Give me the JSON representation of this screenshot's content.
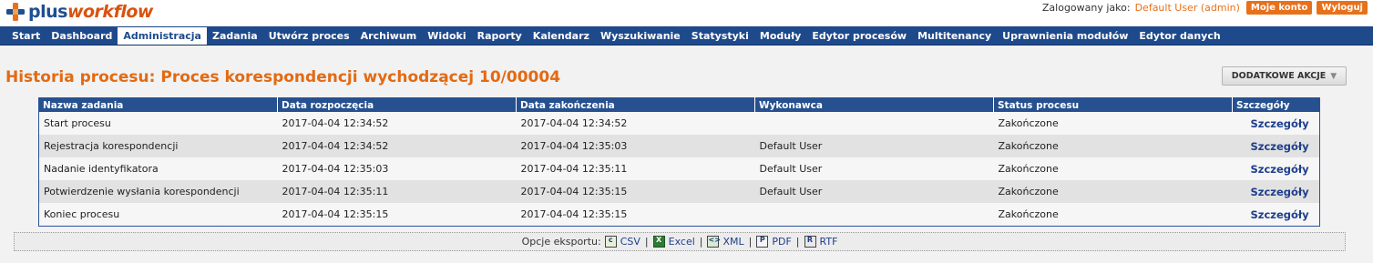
{
  "app": {
    "logo_plus": "plus",
    "logo_workflow": "workflow"
  },
  "user": {
    "logged_in_label": "Zalogowany jako:",
    "name": "Default User (admin)",
    "my_account": "Moje konto",
    "logout": "Wyloguj"
  },
  "nav": {
    "items": [
      {
        "label": "Start"
      },
      {
        "label": "Dashboard"
      },
      {
        "label": "Administracja",
        "active": true
      },
      {
        "label": "Zadania"
      },
      {
        "label": "Utwórz proces"
      },
      {
        "label": "Archiwum"
      },
      {
        "label": "Widoki"
      },
      {
        "label": "Raporty"
      },
      {
        "label": "Kalendarz"
      },
      {
        "label": "Wyszukiwanie"
      },
      {
        "label": "Statystyki"
      },
      {
        "label": "Moduły"
      },
      {
        "label": "Edytor procesów"
      },
      {
        "label": "Multitenancy"
      },
      {
        "label": "Uprawnienia modułów"
      },
      {
        "label": "Edytor danych"
      }
    ]
  },
  "page": {
    "title": "Historia procesu: Proces korespondencji wychodzącej 10/00004",
    "actions_button": "DODATKOWE AKCJE",
    "actions_caret_icon": "caret-down-icon"
  },
  "table": {
    "columns": [
      "Nazwa zadania",
      "Data rozpoczęcia",
      "Data zakończenia",
      "Wykonawca",
      "Status procesu",
      "Szczegóły"
    ],
    "rows": [
      {
        "task": "Start procesu",
        "start": "2017-04-04 12:34:52",
        "end": "2017-04-04 12:34:52",
        "assignee": "",
        "status": "Zakończone",
        "details": "Szczegóły"
      },
      {
        "task": "Rejestracja korespondencji",
        "start": "2017-04-04 12:34:52",
        "end": "2017-04-04 12:35:03",
        "assignee": "Default User",
        "status": "Zakończone",
        "details": "Szczegóły"
      },
      {
        "task": "Nadanie identyfikatora",
        "start": "2017-04-04 12:35:03",
        "end": "2017-04-04 12:35:11",
        "assignee": "Default User",
        "status": "Zakończone",
        "details": "Szczegóły"
      },
      {
        "task": "Potwierdzenie wysłania korespondencji",
        "start": "2017-04-04 12:35:11",
        "end": "2017-04-04 12:35:15",
        "assignee": "Default User",
        "status": "Zakończone",
        "details": "Szczegóły"
      },
      {
        "task": "Koniec procesu",
        "start": "2017-04-04 12:35:15",
        "end": "2017-04-04 12:35:15",
        "assignee": "",
        "status": "Zakończone",
        "details": "Szczegóły"
      }
    ]
  },
  "export": {
    "label": "Opcje eksportu:",
    "options": [
      {
        "label": "CSV",
        "icon": "csv-icon"
      },
      {
        "label": "Excel",
        "icon": "excel-icon"
      },
      {
        "label": "XML",
        "icon": "xml-icon"
      },
      {
        "label": "PDF",
        "icon": "pdf-icon"
      },
      {
        "label": "RTF",
        "icon": "rtf-icon"
      }
    ]
  },
  "colors": {
    "accent_orange": "#e8701a",
    "nav_blue": "#1e4a8c",
    "title_orange": "#e36a12",
    "link_blue": "#1e3f8c"
  }
}
